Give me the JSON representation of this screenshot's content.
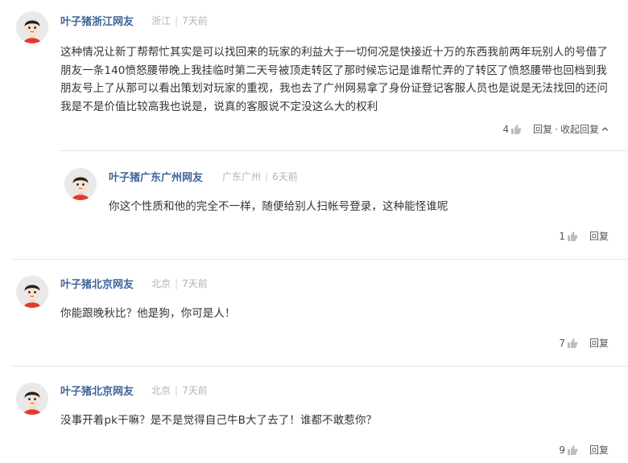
{
  "comments": [
    {
      "username": "叶子猪浙江网友",
      "location": "浙江",
      "time": "7天前",
      "text": "这种情况让新丁帮帮忙其实是可以找回来的玩家的利益大于一切何况是快接近十万的东西我前两年玩别人的号借了朋友一条140愤怒腰带晚上我挂临时第二天号被顶走转区了那时候忘记是谁帮忙弄的了转区了愤怒腰带也回档到我朋友号上了从那可以看出策划对玩家的重视，我也去了广州网易拿了身份证登记客服人员也是说是无法找回的还问我是不是价值比较高我也说是，说真的客服说不定没这么大的权利",
      "likes": "4",
      "reply_label": "回复",
      "collapse_label": "收起回复"
    },
    {
      "username": "叶子猪广东广州网友",
      "location": "广东广州",
      "time": "6天前",
      "text": "你这个性质和他的完全不一样，随便给别人扫帐号登录，这种能怪谁呢",
      "likes": "1",
      "reply_label": "回复"
    },
    {
      "username": "叶子猪北京网友",
      "location": "北京",
      "time": "7天前",
      "text": "你能跟晚秋比？他是狗，你可是人！",
      "likes": "7",
      "reply_label": "回复"
    },
    {
      "username": "叶子猪北京网友",
      "location": "北京",
      "time": "7天前",
      "text": "没事开着pk干嘛？是不是觉得自己牛B大了去了！谁都不敢惹你？",
      "likes": "9",
      "reply_label": "回复"
    }
  ],
  "separators": {
    "meta": "|",
    "action": "·"
  },
  "colors": {
    "username": "#406599",
    "meta": "#b3b3b3",
    "text": "#333333",
    "divider": "#e8e8e8",
    "avatar_bg": "#e9e9e9",
    "shirt": "#e23b2e"
  },
  "icons": {
    "avatar": "pig-avatar-icon",
    "like": "thumbs-up-icon",
    "collapse": "chevron-up-icon"
  }
}
